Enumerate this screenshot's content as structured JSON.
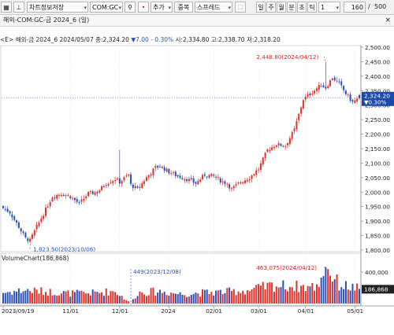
{
  "toolbar": {
    "chart_name": "차트정보저장",
    "symbol": "COM:GC",
    "add_label": "추가",
    "overlap_label": "중복",
    "spread_label": "스프레드",
    "period_buttons": [
      "일",
      "주",
      "월",
      "분",
      "초",
      "틱"
    ],
    "active_period": "일",
    "interval_value": "1",
    "count_value": "160",
    "count_total": "500"
  },
  "subbar": {
    "title": "해외-COM:GC-금 2024_6 (일)"
  },
  "info_line": {
    "prefix": "<E> 해외-금 2024_6",
    "date": "2024/05/07",
    "close": "종:2,324.20",
    "change": "7.00",
    "change_pct": "- 0.30%",
    "open": "시:2,334.80",
    "high": "고:2,338.70",
    "low": "저:2,318.20"
  },
  "current_price_label": {
    "price": "2,324.20",
    "change": "- 0.30%"
  },
  "volume_header": "VolumeChart(186,868)",
  "volume_current_label": "186,868",
  "colors": {
    "up": "#e0322c",
    "down": "#2b4fb8",
    "current": "#1c4aa8",
    "text": "#222222",
    "grid": "#d9d9d9"
  },
  "chart_data": {
    "type": "candlestick",
    "title": "해외-COM:GC-금 2024_6 (일)",
    "price_axis": {
      "min": 1800,
      "max": 2500,
      "ticks": [
        "1,800.00",
        "1,850.00",
        "1,900.00",
        "1,950.00",
        "2,000.00",
        "2,050.00",
        "2,100.00",
        "2,150.00",
        "2,200.00",
        "2,250.00",
        "2,300.00",
        "2,350.00",
        "2,400.00",
        "2,450.00",
        "2,500.00"
      ]
    },
    "volume_axis": {
      "min": 0,
      "max": 500000,
      "ticks": [
        "400,000"
      ]
    },
    "x_tick_labels": [
      {
        "label": "2023/09/19",
        "idx": 0
      },
      {
        "label": "11/01",
        "idx": 30
      },
      {
        "label": "12/01",
        "idx": 52
      },
      {
        "label": "2024",
        "idx": 74
      },
      {
        "label": "02/01",
        "idx": 94
      },
      {
        "label": "03/01",
        "idx": 114
      },
      {
        "label": "04/01",
        "idx": 135
      },
      {
        "label": "05/01",
        "idx": 157
      }
    ],
    "annotations": [
      {
        "text": "2,448.80(2024/04/12)",
        "type": "high",
        "value": 2448.8,
        "idx": 144
      },
      {
        "text": "1,823.50(2023/10/06)",
        "type": "low",
        "value": 1823.5,
        "idx": 12
      },
      {
        "text": "449(2023/12/08)",
        "type": "volume_low",
        "value": 449,
        "idx": 57
      },
      {
        "text": "463,075(2024/04/12)",
        "type": "volume_high",
        "value": 463075,
        "idx": 144
      }
    ],
    "last": {
      "open": 2334.8,
      "high": 2338.7,
      "low": 2318.2,
      "close": 2324.2,
      "volume": 186868
    },
    "close_anchors": [
      [
        0,
        1945
      ],
      [
        3,
        1930
      ],
      [
        7,
        1880
      ],
      [
        10,
        1840
      ],
      [
        12,
        1833
      ],
      [
        14,
        1865
      ],
      [
        18,
        1925
      ],
      [
        22,
        1985
      ],
      [
        26,
        1995
      ],
      [
        30,
        1985
      ],
      [
        34,
        1960
      ],
      [
        38,
        1995
      ],
      [
        42,
        2000
      ],
      [
        46,
        2030
      ],
      [
        50,
        2045
      ],
      [
        52,
        2035
      ],
      [
        56,
        2060
      ],
      [
        57,
        2025
      ],
      [
        60,
        2010
      ],
      [
        64,
        2050
      ],
      [
        68,
        2085
      ],
      [
        70,
        2090
      ],
      [
        74,
        2070
      ],
      [
        78,
        2055
      ],
      [
        82,
        2045
      ],
      [
        86,
        2030
      ],
      [
        90,
        2060
      ],
      [
        94,
        2055
      ],
      [
        98,
        2035
      ],
      [
        100,
        2030
      ],
      [
        102,
        2010
      ],
      [
        106,
        2035
      ],
      [
        110,
        2050
      ],
      [
        114,
        2080
      ],
      [
        118,
        2145
      ],
      [
        122,
        2165
      ],
      [
        126,
        2160
      ],
      [
        130,
        2215
      ],
      [
        134,
        2320
      ],
      [
        138,
        2345
      ],
      [
        142,
        2370
      ],
      [
        144,
        2360
      ],
      [
        147,
        2395
      ],
      [
        150,
        2375
      ],
      [
        153,
        2340
      ],
      [
        156,
        2310
      ],
      [
        159,
        2324.2
      ]
    ],
    "volume_anchors": [
      [
        0,
        140000
      ],
      [
        10,
        170000
      ],
      [
        20,
        150000
      ],
      [
        30,
        130000
      ],
      [
        40,
        135000
      ],
      [
        50,
        160000
      ],
      [
        57,
        449
      ],
      [
        60,
        140000
      ],
      [
        70,
        155000
      ],
      [
        80,
        120000
      ],
      [
        90,
        140000
      ],
      [
        100,
        150000
      ],
      [
        110,
        170000
      ],
      [
        120,
        230000
      ],
      [
        130,
        220000
      ],
      [
        140,
        210000
      ],
      [
        144,
        463075
      ],
      [
        150,
        240000
      ],
      [
        159,
        186868
      ]
    ]
  }
}
